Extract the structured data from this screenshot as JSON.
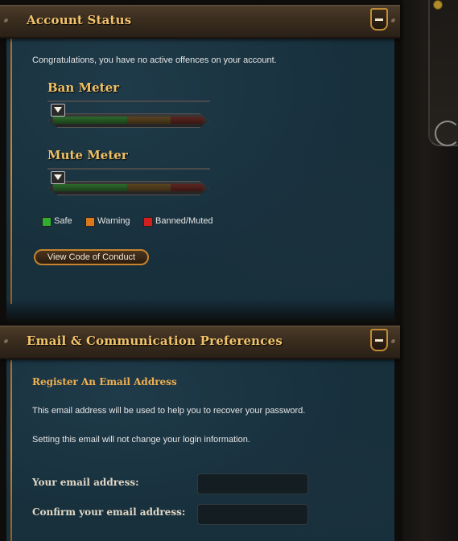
{
  "account_status": {
    "title": "Account Status",
    "collapse_label": "−",
    "message": "Congratulations, you have no active offences on your account.",
    "ban_meter": {
      "title": "Ban Meter",
      "level": 0
    },
    "mute_meter": {
      "title": "Mute Meter",
      "level": 0
    },
    "legend": [
      {
        "label": "Safe",
        "color": "#2fae2f"
      },
      {
        "label": "Warning",
        "color": "#d9781c"
      },
      {
        "label": "Banned/Muted",
        "color": "#d11f1f"
      }
    ],
    "code_of_conduct_button": "View Code of Conduct"
  },
  "email_prefs": {
    "title": "Email & Communication Preferences",
    "collapse_label": "−",
    "register_title": "Register An Email Address",
    "info_1": "This email address will be used to help you to recover your password.",
    "info_2": "Setting this email will not change your login information.",
    "email_label": "Your email address:",
    "email_value": "",
    "confirm_label": "Confirm your email address:",
    "confirm_value": ""
  },
  "colors": {
    "accent_gold": "#f0c064",
    "rail_orange": "#e0861d",
    "panel_blue": "#17303c"
  },
  "icons": [
    "collapse-icon",
    "meter-pointer-icon"
  ]
}
